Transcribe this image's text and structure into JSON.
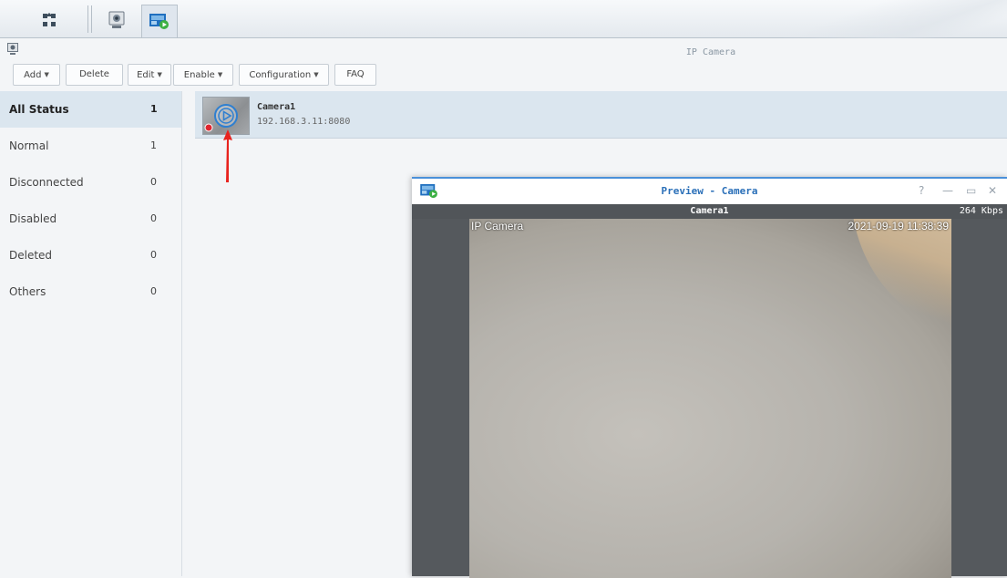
{
  "taskbar": {
    "icons": [
      "apps-grid-icon",
      "ip-camera-app-icon",
      "surveillance-app-icon"
    ]
  },
  "app": {
    "title": "IP Camera",
    "icon": "ip-camera-app-icon"
  },
  "toolbar": {
    "add_label": "Add",
    "delete_label": "Delete",
    "edit_label": "Edit",
    "enable_label": "Enable",
    "configuration_label": "Configuration",
    "faq_label": "FAQ"
  },
  "sidebar": {
    "items": [
      {
        "label": "All Status",
        "count": "1"
      },
      {
        "label": "Normal",
        "count": "1"
      },
      {
        "label": "Disconnected",
        "count": "0"
      },
      {
        "label": "Disabled",
        "count": "0"
      },
      {
        "label": "Deleted",
        "count": "0"
      },
      {
        "label": "Others",
        "count": "0"
      }
    ]
  },
  "camera": {
    "name": "Camera1",
    "address": "192.168.3.11:8080",
    "status_color": "#e0262f"
  },
  "preview": {
    "title": "Preview - Camera",
    "camera_name": "Camera1",
    "bitrate": "264 Kbps",
    "osd_label": "IP Camera",
    "osd_timestamp": "2021-09-19 11:38:39",
    "controls": {
      "help": "?",
      "minimize": "—",
      "maximize": "▭",
      "close": "✕"
    }
  },
  "colors": {
    "accent": "#4a90d9",
    "selected_row": "#dbe6ef",
    "annotation_arrow": "#e8231e"
  }
}
